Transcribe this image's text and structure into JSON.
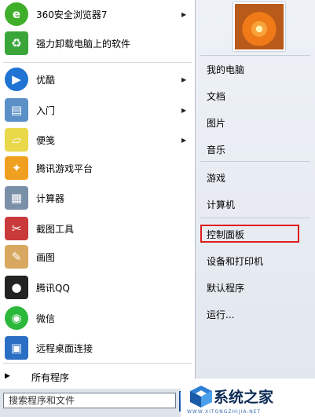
{
  "left_menu": {
    "items": [
      {
        "label": "360安全浏览器7",
        "icon": "360-browser-icon",
        "color": "#3fae2a",
        "glyph": "e",
        "has_arrow": true
      },
      {
        "label": "强力卸载电脑上的软件",
        "icon": "uninstall-icon",
        "color": "#3aa63a",
        "glyph": "♻",
        "has_arrow": false
      },
      {
        "label": "优酷",
        "icon": "youku-icon",
        "color": "#1f73d2",
        "glyph": "▶",
        "has_arrow": true
      },
      {
        "label": "入门",
        "icon": "getting-started-icon",
        "color": "#5a8fc7",
        "glyph": "▤",
        "has_arrow": true
      },
      {
        "label": "便笺",
        "icon": "sticky-notes-icon",
        "color": "#e8d84a",
        "glyph": "▱",
        "has_arrow": true
      },
      {
        "label": "腾讯游戏平台",
        "icon": "tencent-games-icon",
        "color": "#f0a020",
        "glyph": "✦",
        "has_arrow": false
      },
      {
        "label": "计算器",
        "icon": "calculator-icon",
        "color": "#7a8fa8",
        "glyph": "▦",
        "has_arrow": false
      },
      {
        "label": "截图工具",
        "icon": "snipping-tool-icon",
        "color": "#c93a3a",
        "glyph": "✂",
        "has_arrow": false
      },
      {
        "label": "画图",
        "icon": "paint-icon",
        "color": "#d8a860",
        "glyph": "✎",
        "has_arrow": false
      },
      {
        "label": "腾讯QQ",
        "icon": "qq-penguin-icon",
        "color": "#222222",
        "glyph": "●",
        "has_arrow": false
      },
      {
        "label": "微信",
        "icon": "wechat-icon",
        "color": "#2cb83a",
        "glyph": "◉",
        "has_arrow": false
      },
      {
        "label": "远程桌面连接",
        "icon": "remote-desktop-icon",
        "color": "#2a6fc4",
        "glyph": "▣",
        "has_arrow": false
      }
    ],
    "all_programs": "所有程序",
    "search_placeholder": "搜索程序和文件"
  },
  "right_menu": {
    "items": [
      "我的电脑",
      "文档",
      "图片",
      "音乐",
      "游戏",
      "计算机",
      "控制面板",
      "设备和打印机",
      "默认程序",
      "运行..."
    ],
    "highlighted": "控制面板"
  },
  "watermark": {
    "text": "系统之家",
    "url": "WWW.XITONGZHIJIA.NET"
  },
  "colors": {
    "highlight_border": "#e01b1b",
    "pane_border": "#b5bdc8"
  }
}
